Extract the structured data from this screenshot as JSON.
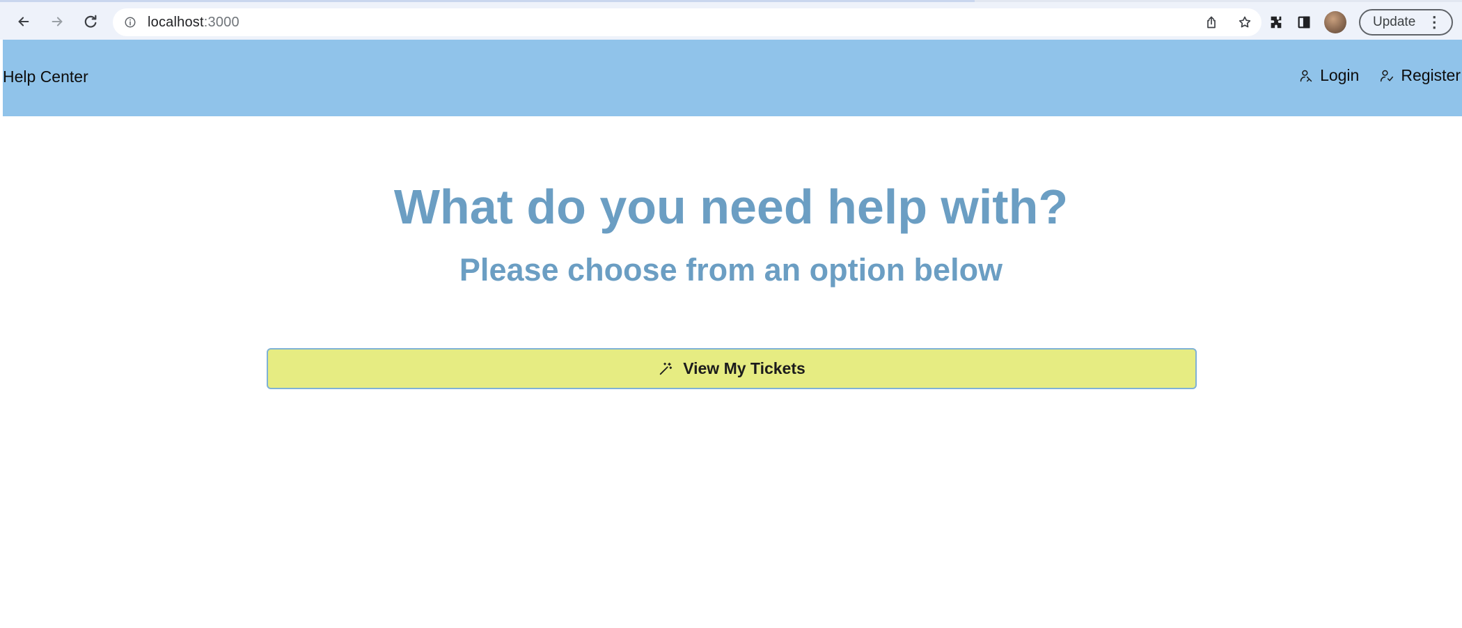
{
  "browser": {
    "url_host": "localhost",
    "url_port": ":3000",
    "update_label": "Update",
    "icons": [
      "back-icon",
      "forward-icon",
      "reload-icon",
      "info-icon",
      "share-icon",
      "star-icon",
      "extensions-icon",
      "side-panel-icon",
      "avatar",
      "kebab-icon"
    ]
  },
  "header": {
    "brand": "Help Center",
    "login_label": "Login",
    "register_label": "Register",
    "background": "#90c3ea"
  },
  "main": {
    "title": "What do you need help with?",
    "subtitle": "Please choose from an option below",
    "tickets_button_label": "View My Tickets",
    "tickets_button_icon": "magic-wand-icon",
    "heading_color": "#6b9ec3",
    "button_color": "#e6ec82"
  }
}
